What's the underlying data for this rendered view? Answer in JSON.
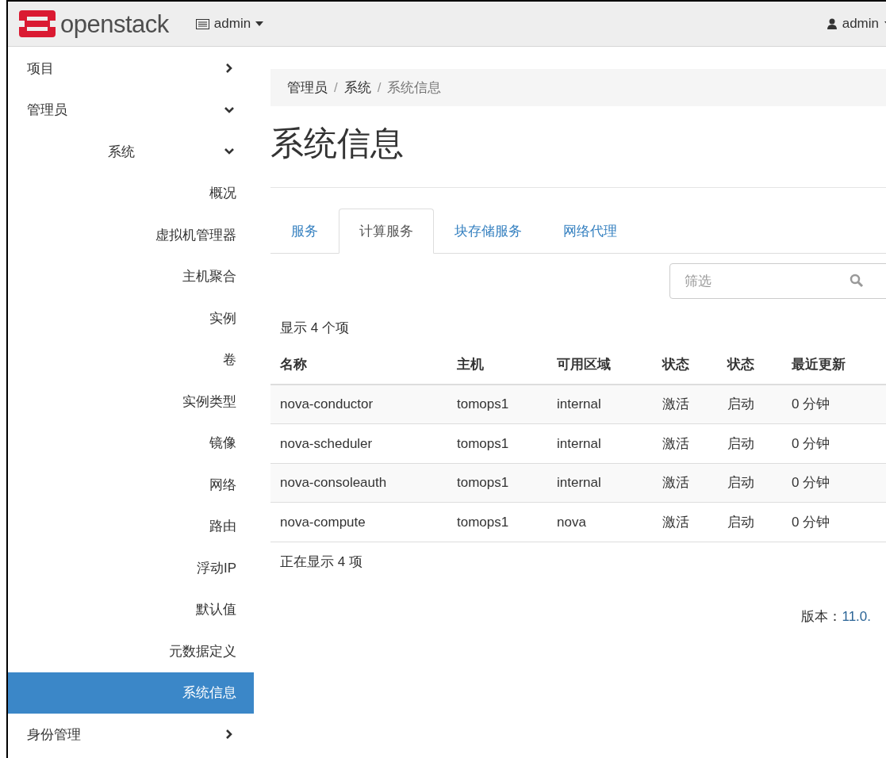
{
  "header": {
    "logo": "openstack",
    "project_menu": "admin",
    "user_menu": "admin"
  },
  "sidebar": {
    "items": [
      {
        "label": "项目",
        "expanded": false
      },
      {
        "label": "管理员",
        "expanded": true,
        "children": [
          {
            "label": "系统",
            "expanded": true,
            "children": [
              {
                "label": "概况",
                "selected": false
              },
              {
                "label": "虚拟机管理器",
                "selected": false
              },
              {
                "label": "主机聚合",
                "selected": false
              },
              {
                "label": "实例",
                "selected": false
              },
              {
                "label": "卷",
                "selected": false
              },
              {
                "label": "实例类型",
                "selected": false
              },
              {
                "label": "镜像",
                "selected": false
              },
              {
                "label": "网络",
                "selected": false
              },
              {
                "label": "路由",
                "selected": false
              },
              {
                "label": "浮动IP",
                "selected": false
              },
              {
                "label": "默认值",
                "selected": false
              },
              {
                "label": "元数据定义",
                "selected": false
              },
              {
                "label": "系统信息",
                "selected": true
              }
            ]
          }
        ]
      },
      {
        "label": "身份管理",
        "expanded": false
      }
    ]
  },
  "breadcrumb": [
    "管理员",
    "系统",
    "系统信息"
  ],
  "breadcrumb_separator": "/",
  "title": "系统信息",
  "tabs": [
    {
      "label": "服务",
      "selected": false
    },
    {
      "label": "计算服务",
      "selected": true
    },
    {
      "label": "块存储服务",
      "selected": false
    },
    {
      "label": "网络代理",
      "selected": false
    }
  ],
  "filter": {
    "placeholder": "筛选"
  },
  "count_text": "显示 4 个项",
  "table": {
    "columns": [
      "名称",
      "主机",
      "可用区域",
      "状态",
      "状态",
      "最近更新"
    ],
    "rows": [
      [
        "nova-conductor",
        "tomops1",
        "internal",
        "激活",
        "启动",
        "0 分钟"
      ],
      [
        "nova-scheduler",
        "tomops1",
        "internal",
        "激活",
        "启动",
        "0 分钟"
      ],
      [
        "nova-consoleauth",
        "tomops1",
        "internal",
        "激活",
        "启动",
        "0 分钟"
      ],
      [
        "nova-compute",
        "tomops1",
        "nova",
        "激活",
        "启动",
        "0 分钟"
      ]
    ]
  },
  "footer_text": "正在显示 4 项",
  "version": {
    "label": "版本：",
    "value": "11.0."
  }
}
